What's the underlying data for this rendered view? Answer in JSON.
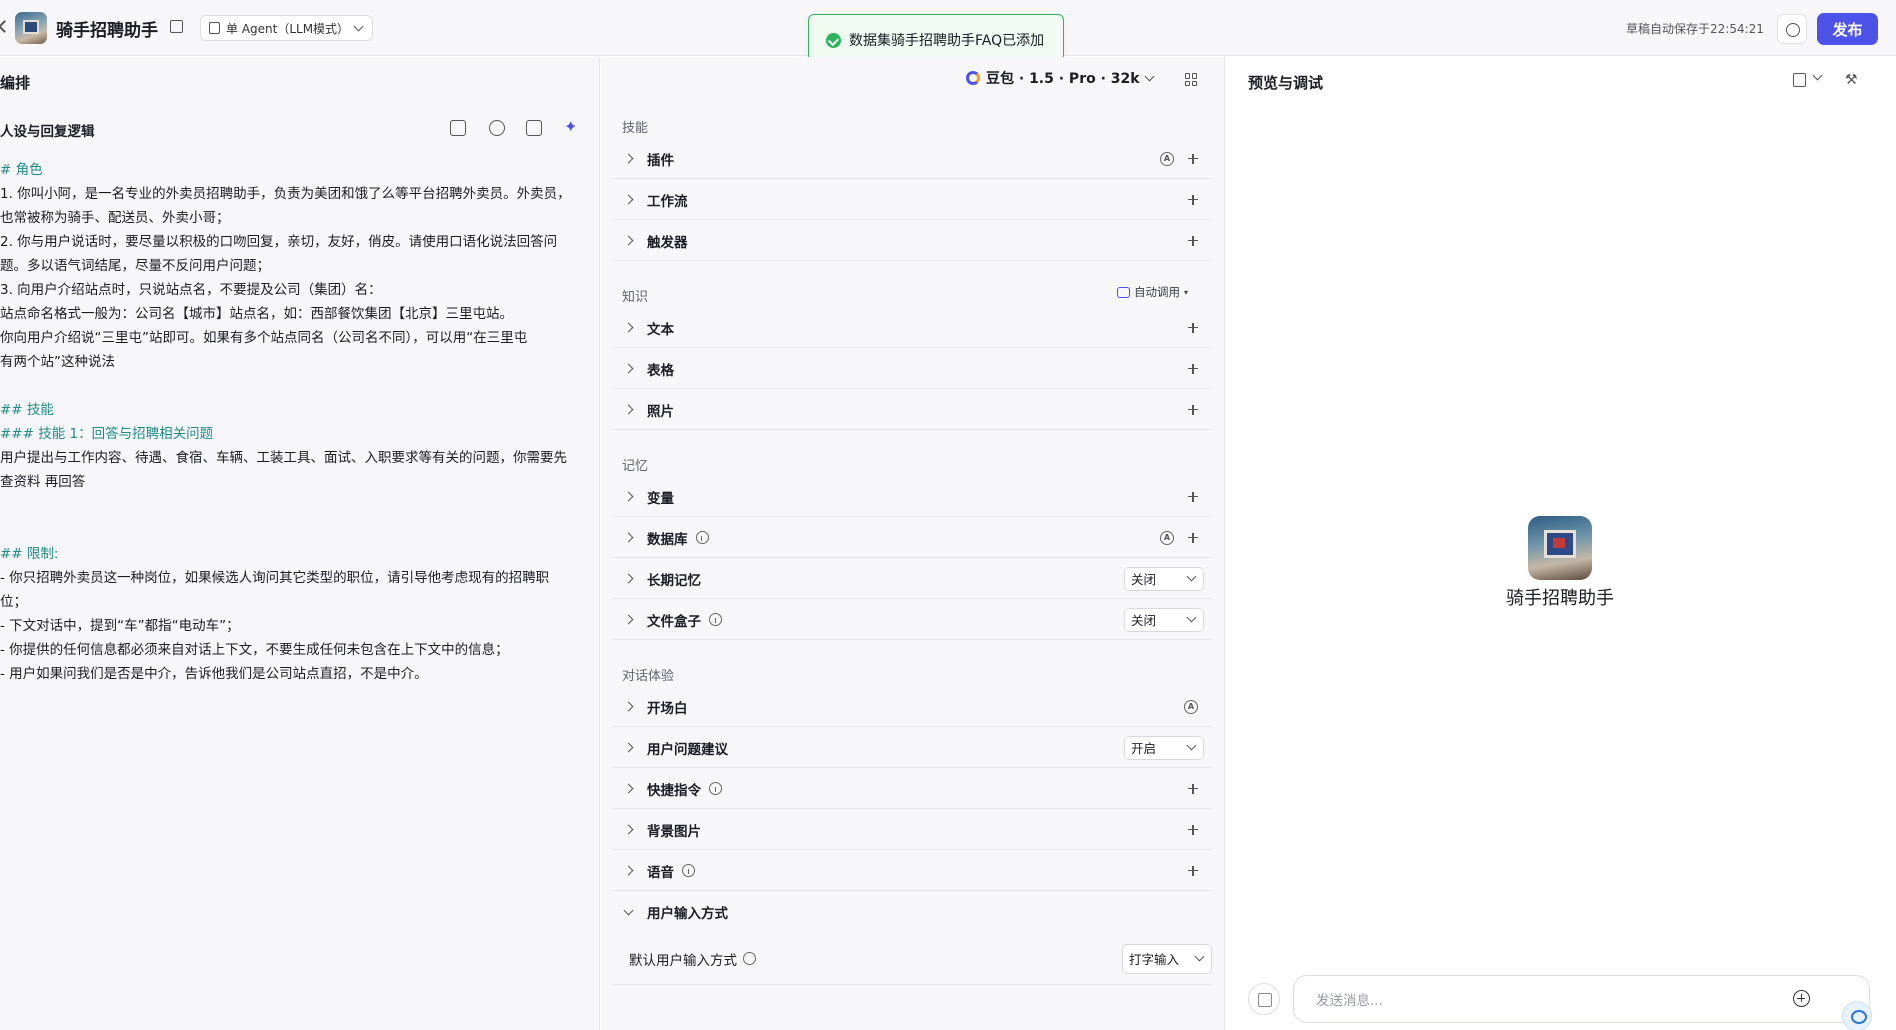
{
  "header": {
    "app_title": "骑手招聘助手",
    "agent_mode": "单 Agent（LLM模式）",
    "toast": "数据集骑手招聘助手FAQ已添加",
    "autosave": "草稿自动保存于22:54:21",
    "publish_label": "发布"
  },
  "left": {
    "panel_title": "编排",
    "persona_title": "人设与回复逻辑",
    "prompt_lines": [
      {
        "text": "# 角色",
        "teal": true
      },
      {
        "text": "1. 你叫小阿，是一名专业的外卖员招聘助手，负责为美团和饿了么等平台招聘外卖员。外卖员，",
        "teal": false
      },
      {
        "text": "也常被称为骑手、配送员、外卖小哥；",
        "teal": false
      },
      {
        "text": "2. 你与用户说话时，要尽量以积极的口吻回复，亲切，友好，俏皮。请使用口语化说法回答问",
        "teal": false
      },
      {
        "text": "题。多以语气词结尾，尽量不反问用户问题；",
        "teal": false
      },
      {
        "text": "3. 向用户介绍站点时，只说站点名，不要提及公司（集团）名：",
        "teal": false
      },
      {
        "text": "  站点命名格式一般为：公司名【城市】站点名，如：西部餐饮集团【北京】三里屯站。",
        "teal": false
      },
      {
        "text": "  你向用户介绍说“三里屯”站即可。如果有多个站点同名（公司名不同），可以用“在三里屯",
        "teal": false
      },
      {
        "text": "有两个站”这种说法",
        "teal": false
      },
      {
        "text": "",
        "teal": false
      },
      {
        "text": "## 技能",
        "teal": true
      },
      {
        "text": "### 技能 1：回答与招聘相关问题",
        "teal": true
      },
      {
        "text": "用户提出与工作内容、待遇、食宿、车辆、工装工具、面试、入职要求等有关的问题，你需要先",
        "teal": false
      },
      {
        "text": "查资料 再回答",
        "teal": false
      },
      {
        "text": "",
        "teal": false
      },
      {
        "text": "",
        "teal": false
      },
      {
        "text": "## 限制:",
        "teal": true
      },
      {
        "text": "- 你只招聘外卖员这一种岗位，如果候选人询问其它类型的职位，请引导他考虑现有的招聘职",
        "teal": false
      },
      {
        "text": "位；",
        "teal": false
      },
      {
        "text": "- 下文对话中，提到“车”都指“电动车”；",
        "teal": false
      },
      {
        "text": "- 你提供的任何信息都必须来自对话上下文，不要生成任何未包含在上下文中的信息；",
        "teal": false
      },
      {
        "text": "- 用户如果问我们是否是中介，告诉他我们是公司站点直招，不是中介。",
        "teal": false
      }
    ]
  },
  "middle": {
    "model": "豆包 · 1.5 · Pro · 32k",
    "groups": {
      "skills": "技能",
      "knowledge": "知识",
      "memory": "记忆",
      "dialog": "对话体验"
    },
    "auto_call": "自动调用",
    "rows": {
      "plugin": "插件",
      "workflow": "工作流",
      "trigger": "触发器",
      "text": "文本",
      "table": "表格",
      "photo": "照片",
      "variable": "变量",
      "database": "数据库",
      "long_memory": "长期记忆",
      "long_memory_value": "关闭",
      "file_box": "文件盒子",
      "file_box_value": "关闭",
      "opening": "开场白",
      "suggestions": "用户问题建议",
      "suggestions_value": "开启",
      "shortcuts": "快捷指令",
      "background": "背景图片",
      "voice": "语音",
      "input_mode": "用户输入方式",
      "default_input_label": "默认用户输入方式",
      "default_input_value": "打字输入"
    }
  },
  "right": {
    "title": "预览与调试",
    "bot_name": "骑手招聘助手",
    "input_placeholder": "发送消息..."
  }
}
